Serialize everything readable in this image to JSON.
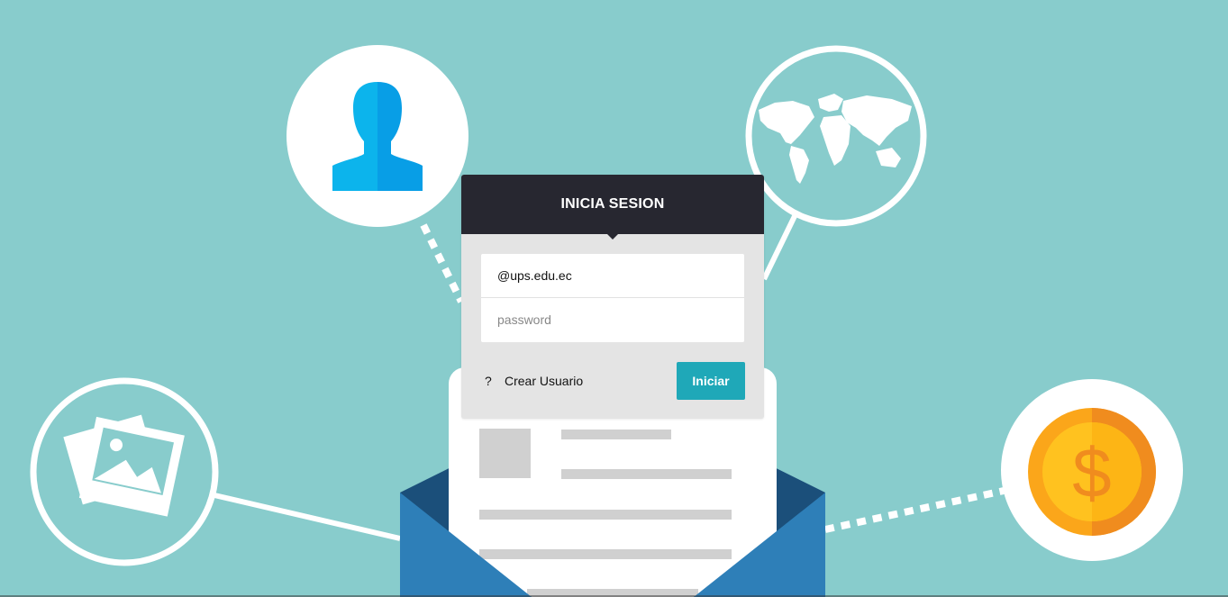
{
  "login": {
    "title": "INICIA SESION",
    "email_value": "@ups.edu.ec",
    "password_placeholder": "password",
    "help_symbol": "?",
    "create_user_label": "Crear Usuario",
    "submit_label": "Iniciar"
  },
  "icons": [
    "user-icon",
    "world-map-icon",
    "photo-icon",
    "dollar-coin-icon",
    "envelope-illustration"
  ],
  "colors": {
    "background": "#88cccc",
    "header": "#272730",
    "card": "#e4e4e4",
    "button": "#1fa8b8",
    "envelope_front": "#2e7fb8",
    "envelope_back": "#1b4f7a"
  }
}
